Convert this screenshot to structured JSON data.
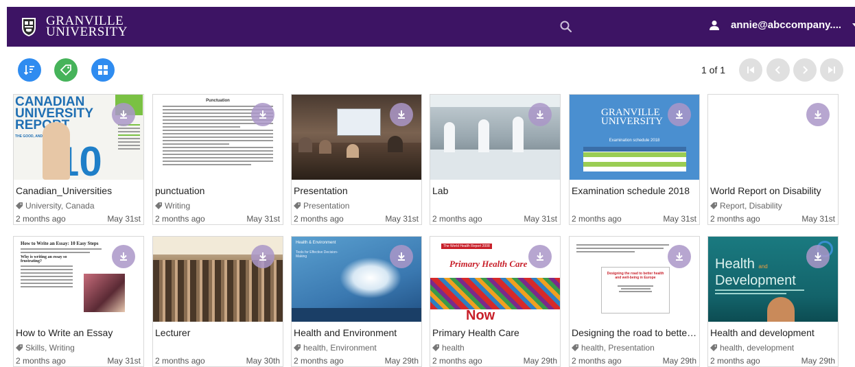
{
  "header": {
    "logo_line1": "GRANVILLE",
    "logo_line2": "UNIVERSITY",
    "user_email": "annie@abccompany....",
    "bg_color": "#3d1464"
  },
  "toolbar": {
    "sort_icon": "sort-icon",
    "tag_icon": "tag-icon",
    "grid_icon": "grid-view-icon"
  },
  "pager": {
    "text": "1 of 1"
  },
  "cards": [
    {
      "title": "Canadian_Universities",
      "tags": "University, Canada",
      "age": "2 months ago",
      "date": "May 31st",
      "thumb_report_l1": "CANADIAN",
      "thumb_report_l2": "UNIVERSITY",
      "thumb_report_l3": "REPORT",
      "thumb_report_num": "10",
      "thumb_report_sub": "THE GOOD, AND WHO"
    },
    {
      "title": "punctuation",
      "tags": "Writing",
      "age": "2 months ago",
      "date": "May 31st",
      "thumb_heading": "Punctuation"
    },
    {
      "title": "Presentation",
      "tags": "Presentation",
      "age": "2 months ago",
      "date": "May 31st"
    },
    {
      "title": "Lab",
      "tags": "",
      "age": "2 months ago",
      "date": "May 31st"
    },
    {
      "title": "Examination schedule 2018",
      "tags": "",
      "age": "2 months ago",
      "date": "May 31st",
      "thumb_logo1": "GRANVILLE",
      "thumb_logo2": "UNIVERSITY",
      "thumb_caption": "Examination schedule 2018"
    },
    {
      "title": "World Report on Disability",
      "tags": "Report, Disability",
      "age": "2 months ago",
      "date": "May 31st"
    },
    {
      "title": "How to Write an Essay",
      "tags": "Skills, Writing",
      "age": "2 months ago",
      "date": "May 31st",
      "thumb_heading": "How to Write an Essay: 10 Easy Steps",
      "thumb_sub": "Why is writing an essay so frustrating?"
    },
    {
      "title": "Lecturer",
      "tags": "",
      "age": "2 months ago",
      "date": "May 30th"
    },
    {
      "title": "Health and Environment",
      "tags": "health, Environment",
      "age": "2 months ago",
      "date": "May 29th",
      "thumb_heading": "Health & Environment",
      "thumb_sub": "Tools for Effective Decision-Making"
    },
    {
      "title": "Primary Health Care",
      "tags": "health",
      "age": "2 months ago",
      "date": "May 29th",
      "thumb_banner": "The World Health Report 2008",
      "thumb_heading": "Primary Health Care",
      "thumb_sub": "Now"
    },
    {
      "title": "Designing the road to better ...",
      "tags": "health, Presentation",
      "age": "2 months ago",
      "date": "May 29th",
      "thumb_heading": "Designing the road to better health and well-being in Europe"
    },
    {
      "title": "Health and development",
      "tags": "health, development",
      "age": "2 months ago",
      "date": "May 29th",
      "thumb_heading1": "Health",
      "thumb_heading_and": "and",
      "thumb_heading2": "Development"
    }
  ]
}
